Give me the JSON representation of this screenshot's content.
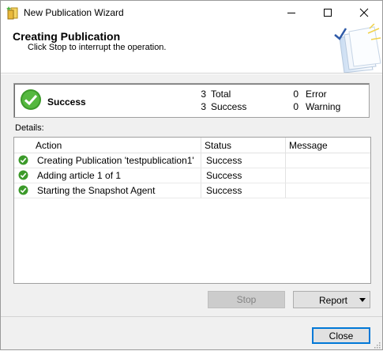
{
  "window": {
    "title": "New Publication Wizard"
  },
  "header": {
    "title": "Creating Publication",
    "subtitle": "Click Stop to interrupt the operation."
  },
  "summary": {
    "status": "Success",
    "total_count": "3",
    "total_label": "Total",
    "success_count": "3",
    "success_label": "Success",
    "error_count": "0",
    "error_label": "Error",
    "warning_count": "0",
    "warning_label": "Warning"
  },
  "details": {
    "label": "Details:",
    "columns": [
      "Action",
      "Status",
      "Message"
    ],
    "rows": [
      {
        "action": "Creating Publication 'testpublication1'",
        "status": "Success",
        "message": ""
      },
      {
        "action": "Adding article 1 of 1",
        "status": "Success",
        "message": ""
      },
      {
        "action": "Starting the Snapshot Agent",
        "status": "Success",
        "message": ""
      }
    ]
  },
  "buttons": {
    "stop": "Stop",
    "report": "Report",
    "close": "Close"
  },
  "icons": {
    "app": "wizard-icon",
    "minimize": "minimize-icon",
    "maximize": "maximize-icon",
    "close": "close-icon",
    "success": "success-check-icon",
    "report_dropdown": "chevron-down-icon"
  },
  "colors": {
    "success_green": "#3c9a2a",
    "accent_blue": "#0078d7",
    "dialog_bg": "#f0f0f0"
  }
}
